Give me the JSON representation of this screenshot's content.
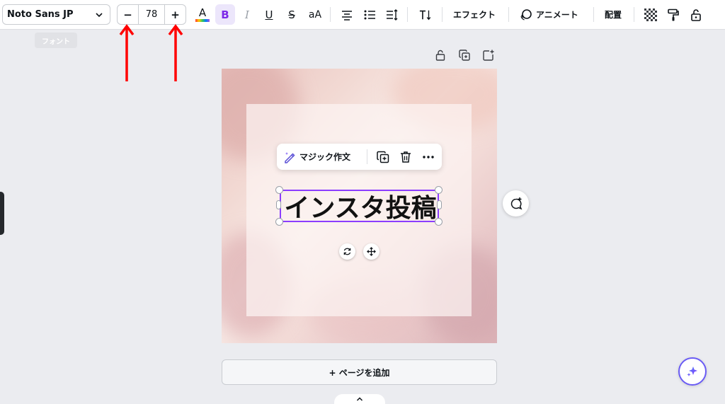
{
  "toolbar": {
    "font_name": "Noto Sans JP",
    "font_size": "78",
    "decrease_label": "−",
    "increase_label": "+",
    "color_letter": "A",
    "bold_label": "B",
    "italic_label": "I",
    "underline_label": "U",
    "strike_label": "S",
    "case_label": "aA",
    "effects_label": "エフェクト",
    "animate_label": "アニメート",
    "position_label": "配置"
  },
  "tooltip": {
    "text": "フォント"
  },
  "context_menu": {
    "magic_write_label": "マジック作文"
  },
  "canvas": {
    "headline_text": "インスタ投稿"
  },
  "footer": {
    "add_page_label": "+ ページを追加"
  },
  "colors": {
    "accent": "#8b3dff",
    "annotation_arrow": "#ff0000",
    "bold_active_bg": "#ece6fb"
  },
  "icons": {
    "font_dropdown": "chevron-down-icon",
    "align": "align-center-icon",
    "list": "bullet-list-icon",
    "spacing": "line-spacing-icon",
    "vertical_text": "vertical-text-icon",
    "animate": "animate-icon",
    "transparency": "transparency-icon",
    "style_copy": "paint-roller-icon",
    "lock": "lock-icon"
  }
}
